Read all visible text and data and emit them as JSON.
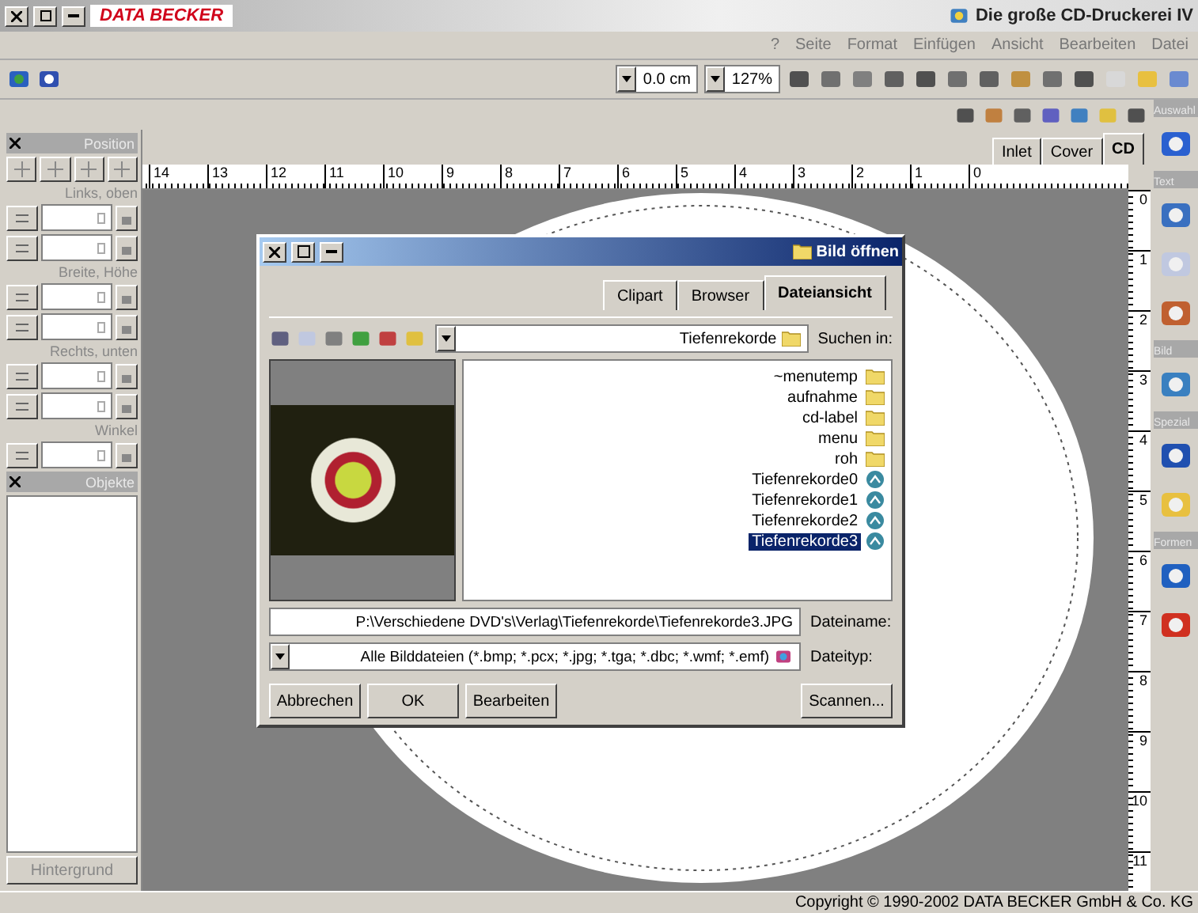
{
  "window": {
    "title": "Die große CD-Druckerei IV",
    "logo": "DATA BECKER"
  },
  "menu": [
    "?",
    "Seite",
    "Format",
    "Einfügen",
    "Ansicht",
    "Bearbeiten",
    "Datei"
  ],
  "toolbar": {
    "zoom": "127%",
    "offset": "0.0 cm"
  },
  "position_panel": {
    "title": "Position",
    "groups": [
      {
        "label": "Links, oben"
      },
      {
        "label": "Breite, Höhe"
      },
      {
        "label": "Rechts, unten"
      },
      {
        "label": "Winkel"
      }
    ]
  },
  "objects_panel": {
    "title": "Objekte",
    "button": "Hintergrund"
  },
  "view_tabs": [
    {
      "label": "Inlet",
      "selected": false
    },
    {
      "label": "Cover",
      "selected": false
    },
    {
      "label": "CD",
      "selected": true
    }
  ],
  "rulers": {
    "horizontal": [
      "14",
      "13",
      "12",
      "11",
      "10",
      "9",
      "8",
      "7",
      "6",
      "5",
      "4",
      "3",
      "2",
      "1",
      "0"
    ],
    "vertical": [
      "0",
      "1",
      "2",
      "3",
      "4",
      "5",
      "6",
      "7",
      "8",
      "9",
      "10",
      "11"
    ]
  },
  "toolbox": [
    {
      "title": "Auswahl"
    },
    {
      "title": "Text"
    },
    {
      "title": "Bild"
    },
    {
      "title": "Spezial"
    },
    {
      "title": "Formen"
    }
  ],
  "dialog": {
    "title": "Bild öffnen",
    "tabs": [
      {
        "label": "Clipart",
        "selected": false
      },
      {
        "label": "Browser",
        "selected": false
      },
      {
        "label": "Dateiansicht",
        "selected": true
      }
    ],
    "look_in_label": "Suchen in:",
    "look_in": "Tiefenrekorde",
    "files": [
      {
        "name": "~menutemp",
        "kind": "folder",
        "selected": false
      },
      {
        "name": "aufnahme",
        "kind": "folder",
        "selected": false
      },
      {
        "name": "cd-label",
        "kind": "folder",
        "selected": false
      },
      {
        "name": "menu",
        "kind": "folder",
        "selected": false
      },
      {
        "name": "roh",
        "kind": "folder",
        "selected": false
      },
      {
        "name": "Tiefenrekorde0",
        "kind": "image",
        "selected": false
      },
      {
        "name": "Tiefenrekorde1",
        "kind": "image",
        "selected": false
      },
      {
        "name": "Tiefenrekorde2",
        "kind": "image",
        "selected": false
      },
      {
        "name": "Tiefenrekorde3",
        "kind": "image",
        "selected": true
      }
    ],
    "filename_label": "Dateiname:",
    "filename": "P:\\Verschiedene DVD's\\Verlag\\Tiefenrekorde\\Tiefenrekorde3.JPG",
    "filetype_label": "Dateityp:",
    "filetype": "Alle Bilddateien (*.bmp; *.pcx; *.jpg; *.tga; *.dbc; *.wmf; *.emf)",
    "buttons": [
      "Abbrechen",
      "OK",
      "Bearbeiten",
      "Scannen..."
    ]
  },
  "status_bar": "Copyright © 1990-2002 DATA BECKER GmbH & Co. KG"
}
